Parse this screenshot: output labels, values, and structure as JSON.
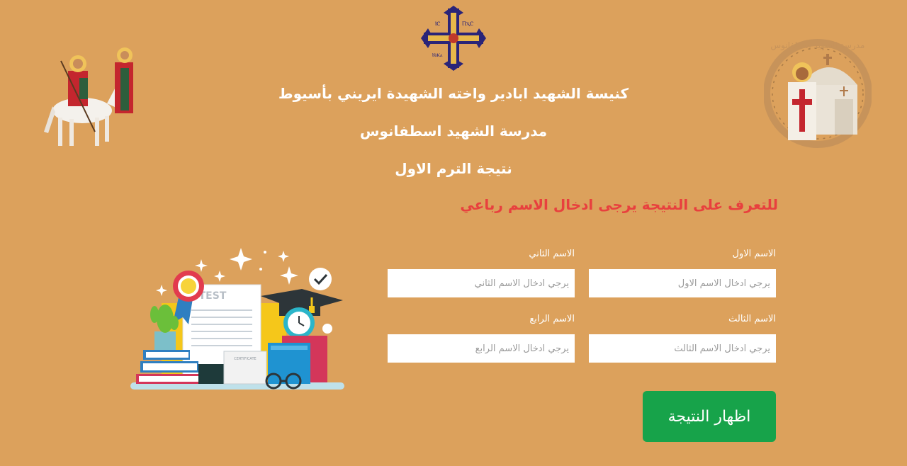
{
  "header": {
    "church_name": "كنيسة الشهيد ابادير واخته الشهيدة ايريني بأسيوط",
    "school_name": "مدرسة الشهيد اسطفانوس",
    "page_heading": "نتيجة الترم الاول",
    "cross_letters": [
      "ⲒⲤ",
      "ⲠⲬⲤ",
      "ⲚⲓⲔⲁ"
    ],
    "school_logo_text": "مدرسة الشهيد اسطفانوس"
  },
  "instruction": "للتعرف على النتيجة يرجى ادخال الاسم رباعي",
  "form": {
    "first_name": {
      "label": "الاسم الاول",
      "placeholder": "يرجي ادخال الاسم الاول",
      "value": ""
    },
    "second_name": {
      "label": "الاسم الثاني",
      "placeholder": "يرجي ادخال الاسم الثاني",
      "value": ""
    },
    "third_name": {
      "label": "الاسم الثالث",
      "placeholder": "يرجي ادخال الاسم الثالث",
      "value": ""
    },
    "fourth_name": {
      "label": "الاسم الرابع",
      "placeholder": "يرجي ادخال الاسم الرابع",
      "value": ""
    },
    "submit_label": "اظهار النتيجة"
  },
  "illustration": {
    "paper_label": "TEST",
    "certificate_label": "CERTIFICATE"
  },
  "colors": {
    "background": "#dca15c",
    "instruction": "#e8403e",
    "button": "#17a34a"
  },
  "icons": {
    "cross": "coptic-cross-icon",
    "saints": "saints-on-horse-icon",
    "logo": "school-logo-icon",
    "illustration": "exam-results-illustration"
  }
}
